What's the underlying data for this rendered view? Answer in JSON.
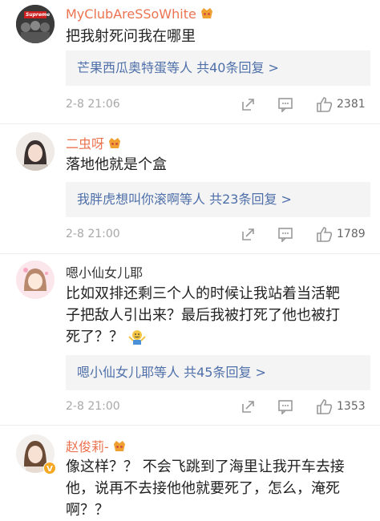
{
  "comments": [
    {
      "user": "MyClubAreSSoWhite",
      "text": "把我射死问我在哪里",
      "reply": {
        "who": "芒果西瓜奥特蛋",
        "tail": "等人 共40条回复 >"
      },
      "time": "2-8 21:06",
      "likes": "2381"
    },
    {
      "user": "二虫呀",
      "text": "落地他就是个盒",
      "reply": {
        "who": "我胖虎想叫你滚啊",
        "tail": "等人 共23条回复 >"
      },
      "time": "2-8 21:00",
      "likes": "1789"
    },
    {
      "user": "嗯小仙女儿耶",
      "text_lines": [
        "比如双排还剩三个人的时候让我站着当活靶",
        "子把敌人引出来？最后我被打死了他也被打",
        "死了？？"
      ],
      "reply": {
        "who": "嗯小仙女儿耶",
        "tail": "等人 共45条回复 >"
      },
      "time": "2-8 21:00",
      "likes": "1353"
    },
    {
      "user": "赵俊莉-",
      "text_lines": [
        "像这样？？ 不会飞跳到了海里让我开车去接",
        "他，说再不去接他他就要死了，怎么，淹死",
        "啊？？"
      ]
    }
  ],
  "avatar_texts": [
    "Supreme"
  ],
  "colors": {
    "vip": "#eb7350",
    "link": "#4e6fa9",
    "gray": "#a8a8a8"
  }
}
